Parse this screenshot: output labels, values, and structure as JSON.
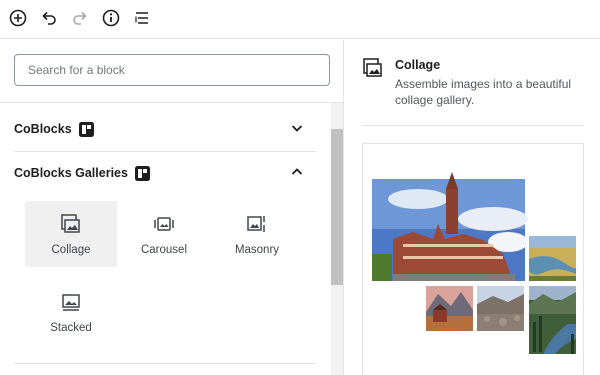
{
  "toolbar": {
    "buttons": [
      {
        "name": "add-block-button",
        "icon": "plus-circle-icon"
      },
      {
        "name": "undo-button",
        "icon": "undo-icon"
      },
      {
        "name": "redo-button",
        "icon": "redo-icon"
      },
      {
        "name": "info-button",
        "icon": "info-icon"
      },
      {
        "name": "outline-button",
        "icon": "list-outline-icon"
      }
    ]
  },
  "inserter": {
    "search_placeholder": "Search for a block",
    "panels": [
      {
        "title": "CoBlocks",
        "expanded": false
      },
      {
        "title": "CoBlocks Galleries",
        "expanded": true,
        "items": [
          {
            "label": "Collage",
            "icon": "collage-icon",
            "selected": true
          },
          {
            "label": "Carousel",
            "icon": "carousel-icon",
            "selected": false
          },
          {
            "label": "Masonry",
            "icon": "masonry-icon",
            "selected": false
          },
          {
            "label": "Stacked",
            "icon": "stacked-icon",
            "selected": false
          }
        ]
      }
    ]
  },
  "preview": {
    "title": "Collage",
    "description": "Assemble images into a beautiful collage gallery.",
    "icon": "collage-icon"
  },
  "colors": {
    "border": "#e2e4e7",
    "text": "#1e1e1e",
    "muted": "#50575e",
    "selected_bg": "#f0f0f1"
  }
}
